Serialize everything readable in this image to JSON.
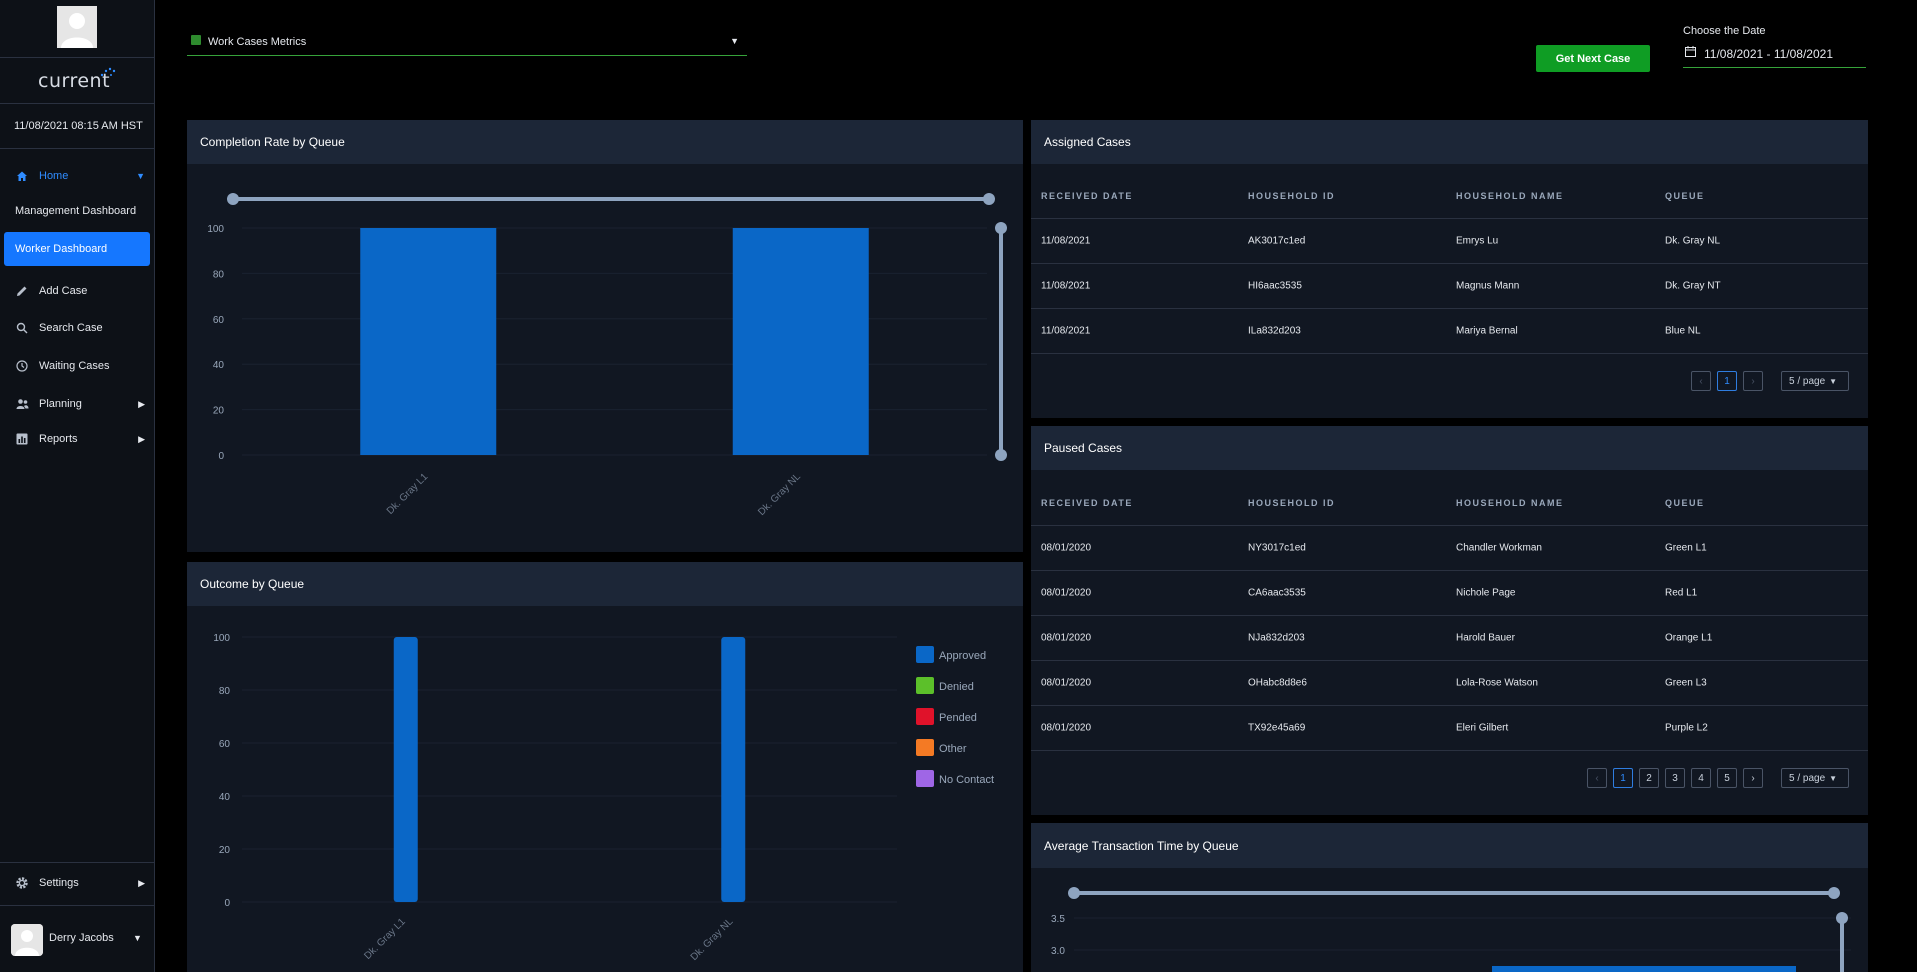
{
  "app": {
    "logo_text": "current",
    "datetime": "11/08/2021 08:15 AM HST"
  },
  "sidebar": {
    "home": "Home",
    "management": "Management Dashboard",
    "worker": "Worker Dashboard",
    "add_case": "Add Case",
    "search_case": "Search Case",
    "waiting_cases": "Waiting Cases",
    "planning": "Planning",
    "reports": "Reports",
    "settings": "Settings",
    "user_name": "Derry Jacobs"
  },
  "topbar": {
    "metrics_select": "Work Cases Metrics",
    "next_button": "Get Next Case",
    "date_label": "Choose the Date",
    "date_range": "11/08/2021 - 11/08/2021"
  },
  "completion": {
    "title": "Completion Rate by Queue",
    "chart_data": {
      "type": "bar",
      "categories": [
        "Dk. Gray L1",
        "Dk. Gray NL"
      ],
      "values": [
        100,
        100
      ],
      "ylim": [
        0,
        100
      ],
      "yticks": [
        "100",
        "80",
        "60",
        "40",
        "20",
        "0"
      ]
    }
  },
  "outcome": {
    "title": "Outcome by Queue",
    "legend": [
      "Approved",
      "Denied",
      "Pended",
      "Other",
      "No Contact"
    ],
    "chart_data": {
      "type": "bar",
      "categories": [
        "Dk. Gray L1",
        "Dk. Gray NL"
      ],
      "series": [
        {
          "name": "Approved",
          "values": [
            100,
            100
          ],
          "color": "#0a67c7"
        },
        {
          "name": "Denied",
          "values": [
            0,
            0
          ],
          "color": "#5cc02a"
        },
        {
          "name": "Pended",
          "values": [
            0,
            0
          ],
          "color": "#e0122a"
        },
        {
          "name": "Other",
          "values": [
            0,
            0
          ],
          "color": "#f47a24"
        },
        {
          "name": "No Contact",
          "values": [
            0,
            0
          ],
          "color": "#9f66e6"
        }
      ],
      "ylim": [
        0,
        100
      ],
      "yticks": [
        "100",
        "80",
        "60",
        "40",
        "20",
        "0"
      ]
    }
  },
  "assigned": {
    "title": "Assigned Cases",
    "columns": [
      "RECEIVED DATE",
      "HOUSEHOLD ID",
      "HOUSEHOLD NAME",
      "QUEUE"
    ],
    "rows": [
      [
        "11/08/2021",
        "AK3017c1ed",
        "Emrys Lu",
        "Dk. Gray NL"
      ],
      [
        "11/08/2021",
        "HI6aac3535",
        "Magnus Mann",
        "Dk. Gray NT"
      ],
      [
        "11/08/2021",
        "ILa832d203",
        "Mariya Bernal",
        "Blue NL"
      ]
    ],
    "pages": [
      "1"
    ],
    "page_size": "5 / page"
  },
  "paused": {
    "title": "Paused Cases",
    "columns": [
      "RECEIVED DATE",
      "HOUSEHOLD ID",
      "HOUSEHOLD NAME",
      "QUEUE"
    ],
    "rows": [
      [
        "08/01/2020",
        "NY3017c1ed",
        "Chandler Workman",
        "Green L1"
      ],
      [
        "08/01/2020",
        "CA6aac3535",
        "Nichole Page",
        "Red L1"
      ],
      [
        "08/01/2020",
        "NJa832d203",
        "Harold Bauer",
        "Orange L1"
      ],
      [
        "08/01/2020",
        "OHabc8d8e6",
        "Lola-Rose Watson",
        "Green L3"
      ],
      [
        "08/01/2020",
        "TX92e45a69",
        "Eleri Gilbert",
        "Purple L2"
      ]
    ],
    "pages": [
      "1",
      "2",
      "3",
      "4",
      "5"
    ],
    "page_size": "5 / page"
  },
  "avg_time": {
    "title": "Average Transaction Time by Queue",
    "yticks": [
      "3.5",
      "3.0"
    ]
  },
  "colors": {
    "accent_blue": "#1577ff",
    "bar_blue": "#0a67c7",
    "green": "#0f9d24",
    "panel_head": "#1c2637",
    "panel_body": "#111722"
  }
}
